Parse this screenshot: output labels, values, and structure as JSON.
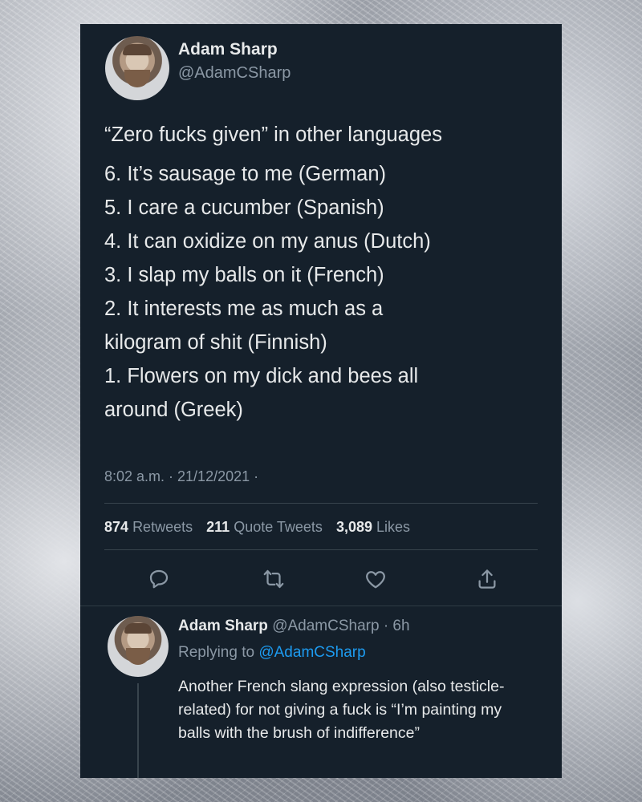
{
  "tweet": {
    "author_name": "Adam Sharp",
    "author_handle": "@AdamCSharp",
    "heading": "“Zero fucks given” in other languages",
    "lines": [
      "6. It’s sausage to me (German)",
      "5. I care a cucumber (Spanish)",
      "4. It can oxidize on my anus (Dutch)",
      "3. I slap my balls on it (French)",
      "2. It interests me as much as a",
      "kilogram of shit (Finnish)",
      "1. Flowers on my dick and bees all",
      "around (Greek)"
    ],
    "timestamp": "8:02 a.m. · 21/12/2021 ·",
    "stats": {
      "retweets_count": "874",
      "retweets_label": "Retweets",
      "quotes_count": "211",
      "quotes_label": "Quote Tweets",
      "likes_count": "3,089",
      "likes_label": "Likes"
    },
    "actions": [
      "reply-icon",
      "retweet-icon",
      "like-icon",
      "share-icon"
    ]
  },
  "reply": {
    "author_name": "Adam Sharp",
    "meta": "@AdamCSharp · 6h",
    "replying_prefix": "Replying to",
    "replying_handle": "@AdamCSharp",
    "text": "Another French slang expression (also testicle-related) for not giving a fuck is “I’m painting my balls with the brush of indifference”"
  },
  "colors": {
    "card_background": "#15202b",
    "primary_text": "#e7e9ea",
    "secondary_text": "#8b98a5",
    "link": "#1d9bf0"
  }
}
